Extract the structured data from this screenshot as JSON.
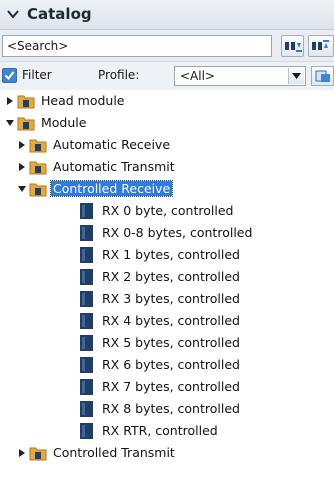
{
  "header": {
    "title": "Catalog"
  },
  "search": {
    "value": "<Search>"
  },
  "filter": {
    "label": "Filter",
    "checked": true,
    "profile_label": "Profile:",
    "profile_value": "<All>"
  },
  "tree": {
    "head_module": "Head module",
    "module": "Module",
    "automatic_receive": "Automatic Receive",
    "automatic_transmit": "Automatic Transmit",
    "controlled_receive": "Controlled Receive",
    "leaves": [
      "RX 0 byte, controlled",
      "RX 0-8 bytes, controlled",
      "RX 1 bytes, controlled",
      "RX 2 bytes, controlled",
      "RX 3 bytes, controlled",
      "RX 4 bytes, controlled",
      "RX 5 bytes, controlled",
      "RX 6 bytes, controlled",
      "RX 7 bytes, controlled",
      "RX 8 bytes, controlled",
      "RX RTR, controlled"
    ],
    "controlled_transmit": "Controlled Transmit"
  },
  "colors": {
    "selection": "#2f7be0",
    "folder": "#e8a93a",
    "module_icon": "#1f3f6b",
    "accent": "#3d86d6"
  }
}
